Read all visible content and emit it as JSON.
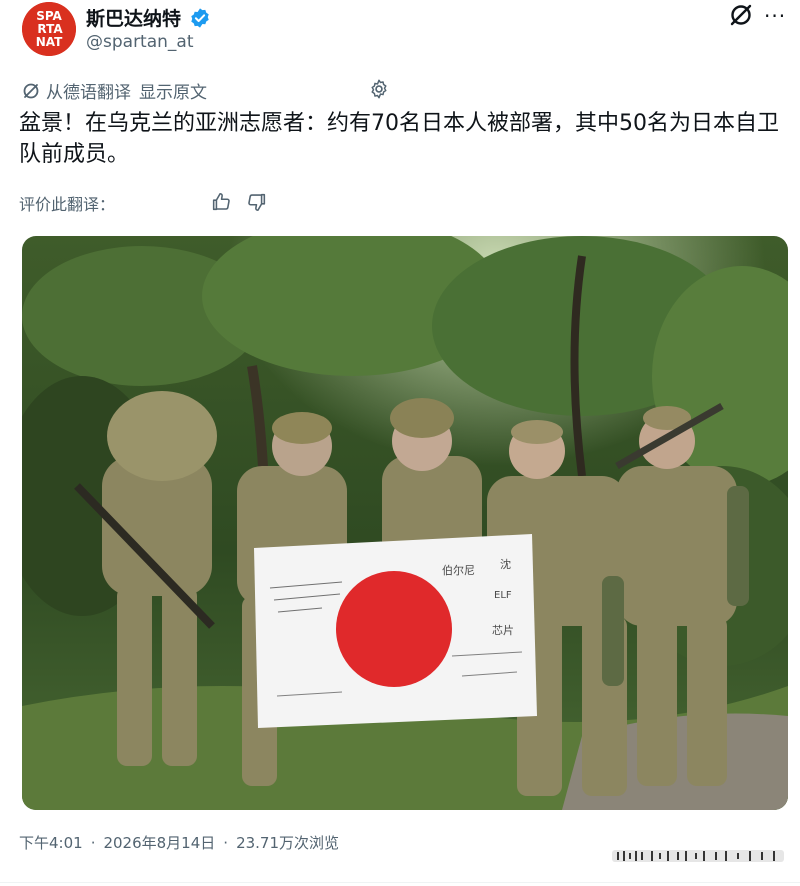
{
  "header": {
    "display_name": "斯巴达纳特",
    "handle": "@spartan_at",
    "avatar_icon": "spartanat-logo",
    "avatar_text": [
      "SPA",
      "RTA",
      "NAT"
    ],
    "verified_icon": "verified-badge-icon",
    "grok_icon": "grok-icon",
    "more_icon": "more-icon",
    "more_label": "···"
  },
  "translation": {
    "translated_from": "从德语翻译",
    "show_original": "显示原文",
    "settings_icon": "gear-icon"
  },
  "tweet": {
    "text": "盆景！在乌克兰的亚洲志愿者：约有70名日本人被部署，其中50名为日本自卫队前成员。"
  },
  "rating": {
    "label": "评价此翻译：",
    "thumbs_up_icon": "thumbs-up-icon",
    "thumbs_down_icon": "thumbs-down-icon"
  },
  "photo": {
    "description_icon": "tweet-photo",
    "flag_signatures": [
      "沈",
      "ELF",
      "芯片",
      "伯尔尼"
    ]
  },
  "meta": {
    "time": "下午4:01",
    "separator": "·",
    "date": "2026年8月14日",
    "views": "23.71万次浏览"
  },
  "colors": {
    "accent": "#1d9bf0",
    "secondary_text": "#536471",
    "primary_text": "#0f1419",
    "avatar_bg": "#d9301f",
    "flag_red": "#e0292b"
  }
}
